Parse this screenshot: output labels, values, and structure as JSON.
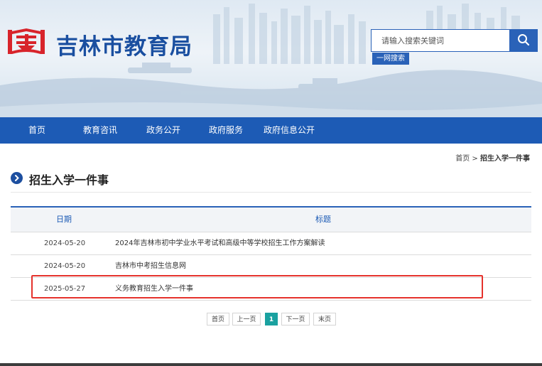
{
  "header": {
    "site_title": "吉林市教育局",
    "logo_icon": "jilin-education-logo",
    "search": {
      "placeholder": "请输入搜索关键词",
      "button_icon": "search-icon",
      "one_net_label": "一网搜索"
    },
    "colors": {
      "brand": "#1d5bb5",
      "logo_red": "#d8242b"
    }
  },
  "nav": {
    "items": [
      {
        "label": "首页"
      },
      {
        "label": "教育咨讯"
      },
      {
        "label": "政务公开"
      },
      {
        "label": "政府服务"
      },
      {
        "label": "政府信息公开"
      }
    ]
  },
  "breadcrumb": {
    "home": "首页",
    "separator": ">",
    "current": "招生入学一件事"
  },
  "section": {
    "title": "招生入学一件事",
    "icon": "chevron-right-circle-icon"
  },
  "table": {
    "headers": {
      "date": "日期",
      "title": "标题"
    },
    "rows": [
      {
        "date": "2024-05-20",
        "title": "2024年吉林市初中学业水平考试和高级中等学校招生工作方案解读"
      },
      {
        "date": "2024-05-20",
        "title": "吉林市中考招生信息网"
      },
      {
        "date": "2025-05-27",
        "title": "义务教育招生入学一件事"
      }
    ],
    "highlight_color": "#e5322c"
  },
  "pagination": {
    "first": "首页",
    "prev": "上一页",
    "current": "1",
    "next": "下一页",
    "last": "末页",
    "active_color": "#1aa1a0"
  }
}
